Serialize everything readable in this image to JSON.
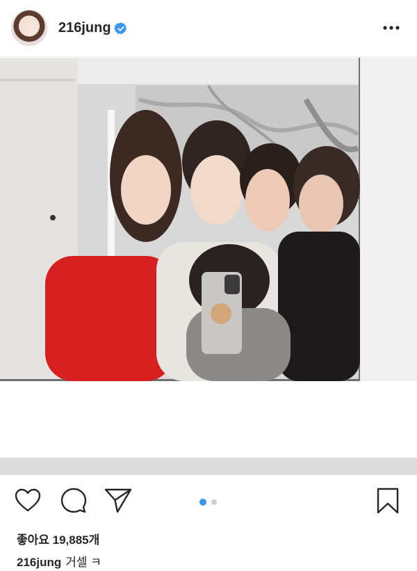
{
  "post": {
    "username": "216jung",
    "verified": true,
    "likes_text": "좋아요 19,885개",
    "caption_user": "216jung",
    "caption_text": "거셀 ㅋ",
    "carousel": {
      "total": 2,
      "active": 1
    }
  },
  "colors": {
    "verified_blue": "#3897f0",
    "dot_active": "#3897f0",
    "dot_inactive": "#d0d0d0",
    "icon_dark": "#262626"
  },
  "icons": {
    "more": "more-options-icon",
    "like": "heart-icon",
    "comment": "comment-icon",
    "share": "paper-plane-icon",
    "save": "bookmark-icon"
  }
}
